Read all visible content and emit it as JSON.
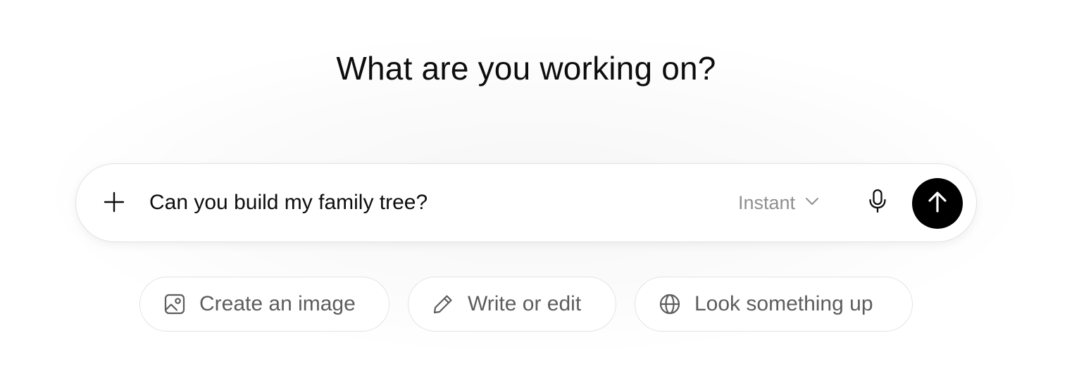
{
  "heading": "What are you working on?",
  "composer": {
    "input_value": "Can you build my family tree?",
    "model_label": "Instant",
    "icons": {
      "attach": "plus-icon",
      "model_dropdown": "chevron-down-icon",
      "voice": "microphone-icon",
      "send": "arrow-up-icon"
    },
    "send_button_color": "#000000"
  },
  "suggestions": [
    {
      "label": "Create an image",
      "icon": "image-icon"
    },
    {
      "label": "Write or edit",
      "icon": "pencil-icon"
    },
    {
      "label": "Look something up",
      "icon": "globe-icon"
    }
  ]
}
